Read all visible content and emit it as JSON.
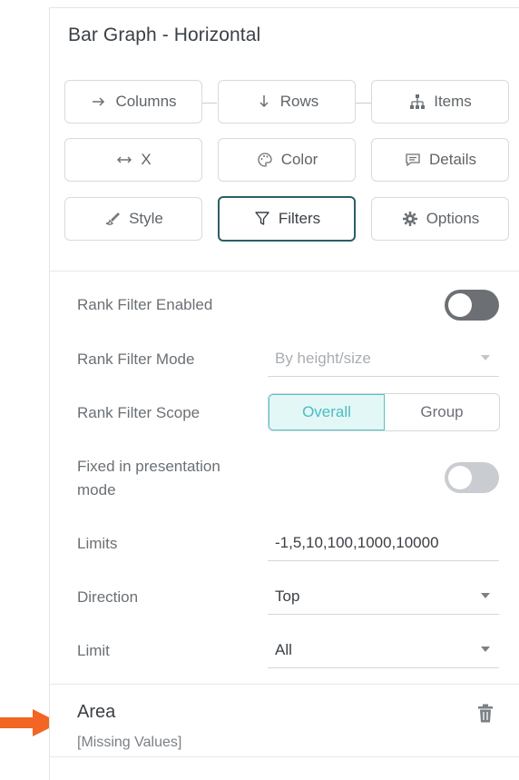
{
  "panel": {
    "title": "Bar Graph - Horizontal"
  },
  "tabs": [
    {
      "label": "Columns",
      "icon": "arrow-right-icon"
    },
    {
      "label": "Rows",
      "icon": "arrow-down-icon"
    },
    {
      "label": "Items",
      "icon": "hierarchy-icon"
    },
    {
      "label": "X",
      "icon": "horizontal-arrows-icon"
    },
    {
      "label": "Color",
      "icon": "palette-icon"
    },
    {
      "label": "Details",
      "icon": "comment-icon"
    },
    {
      "label": "Style",
      "icon": "brush-icon"
    },
    {
      "label": "Filters",
      "icon": "filter-icon",
      "active": true
    },
    {
      "label": "Options",
      "icon": "gear-icon"
    }
  ],
  "filters": {
    "rank_filter_enabled_label": "Rank Filter Enabled",
    "rank_filter_enabled": false,
    "rank_filter_mode_label": "Rank Filter Mode",
    "rank_filter_mode_value": "By height/size",
    "rank_filter_scope_label": "Rank Filter Scope",
    "scope_options": [
      "Overall",
      "Group"
    ],
    "scope_selected": "Overall",
    "fixed_label_line1": "Fixed in presentation",
    "fixed_label_line2": "mode",
    "fixed_enabled": false,
    "limits_label": "Limits",
    "limits_value": "-1,5,10,100,1000,10000",
    "direction_label": "Direction",
    "direction_value": "Top",
    "limit_label": "Limit",
    "limit_value": "All"
  },
  "area_filter": {
    "name": "Area",
    "subtitle": "[Missing Values]"
  },
  "colors": {
    "accent": "#4dbcc1",
    "active_border": "#2c5e66",
    "pointer_arrow": "#f26522"
  }
}
